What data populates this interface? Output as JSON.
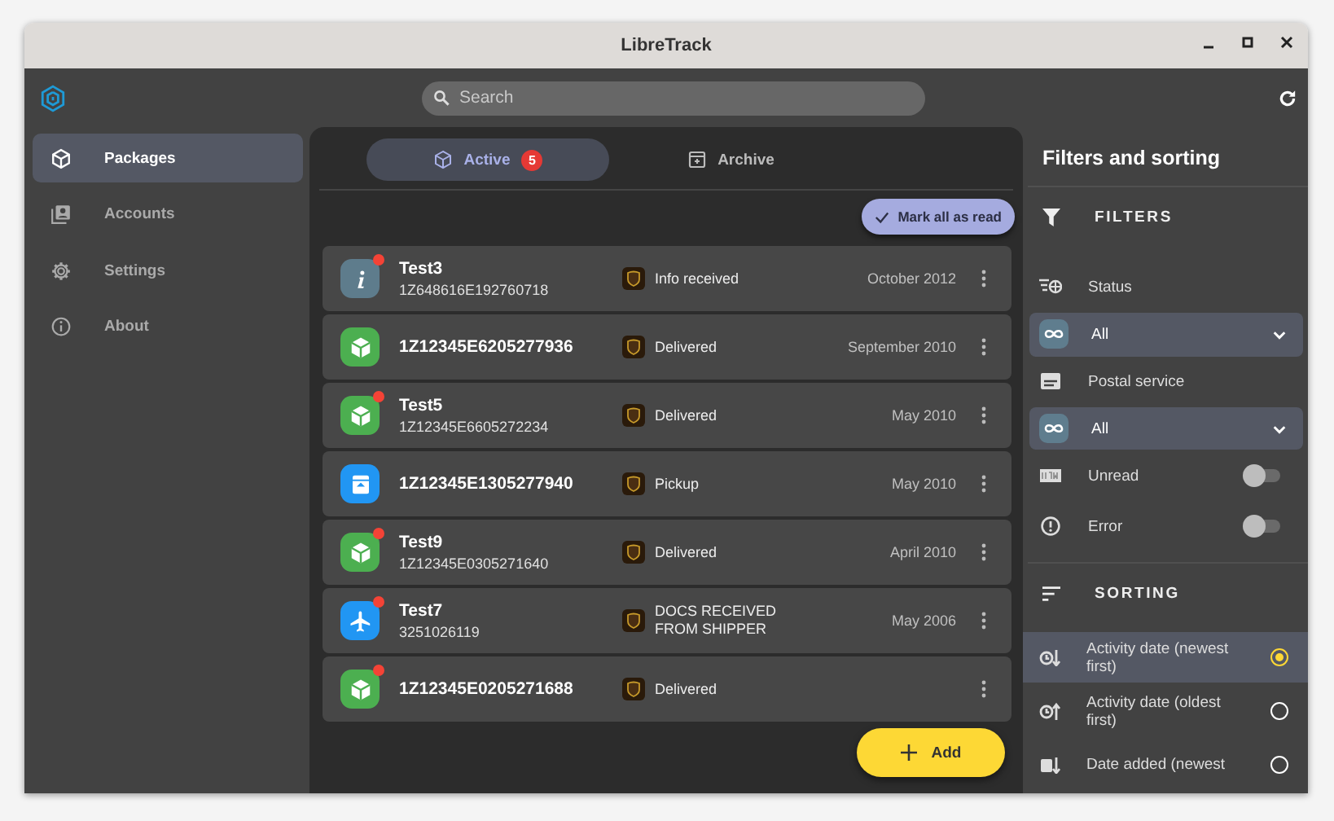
{
  "window": {
    "title": "LibreTrack"
  },
  "toolbar": {
    "search": {
      "placeholder": "Search"
    }
  },
  "sidebar": {
    "items": [
      {
        "label": "Packages",
        "selected": true
      },
      {
        "label": "Accounts",
        "selected": false
      },
      {
        "label": "Settings",
        "selected": false
      },
      {
        "label": "About",
        "selected": false
      }
    ]
  },
  "tabs": [
    {
      "label": "Active",
      "selected": true,
      "badge": "5"
    },
    {
      "label": "Archive",
      "selected": false
    }
  ],
  "mark_all_button": "Mark all as read",
  "packages": [
    {
      "kind": "info",
      "unread": true,
      "name": "Test3",
      "tracking": "1Z648616E192760718",
      "status": "Info received",
      "date": "October 2012"
    },
    {
      "kind": "delivered",
      "unread": false,
      "tracking": "1Z12345E6205277936",
      "status": "Delivered",
      "date": "September 2010"
    },
    {
      "kind": "delivered",
      "unread": true,
      "name": "Test5",
      "tracking": "1Z12345E6605272234",
      "status": "Delivered",
      "date": "May 2010"
    },
    {
      "kind": "pickup",
      "unread": false,
      "tracking": "1Z12345E1305277940",
      "status": "Pickup",
      "date": "May 2010"
    },
    {
      "kind": "delivered",
      "unread": true,
      "name": "Test9",
      "tracking": "1Z12345E0305271640",
      "status": "Delivered",
      "date": "April 2010"
    },
    {
      "kind": "air",
      "unread": true,
      "name": "Test7",
      "tracking": "3251026119",
      "status": "DOCS RECEIVED FROM SHIPPER",
      "date": "May 2006"
    },
    {
      "kind": "delivered",
      "unread": true,
      "tracking": "1Z12345E0205271688",
      "status": "Delivered"
    }
  ],
  "add_button": "Add",
  "filters_panel": {
    "title": "Filters and sorting",
    "filters_heading": "FILTERS",
    "filters": [
      {
        "kind": "dropdown",
        "label": "Status",
        "value": "All"
      },
      {
        "kind": "dropdown",
        "label": "Postal service",
        "value": "All"
      },
      {
        "kind": "toggle",
        "label": "Unread",
        "on": false
      },
      {
        "kind": "toggle",
        "label": "Error",
        "on": false
      }
    ],
    "sorting_heading": "SORTING",
    "sort_options": [
      {
        "label": "Activity date (newest first)",
        "selected": true
      },
      {
        "label": "Activity date (oldest first)",
        "selected": false
      },
      {
        "label": "Date added (newest",
        "selected": false
      }
    ]
  }
}
